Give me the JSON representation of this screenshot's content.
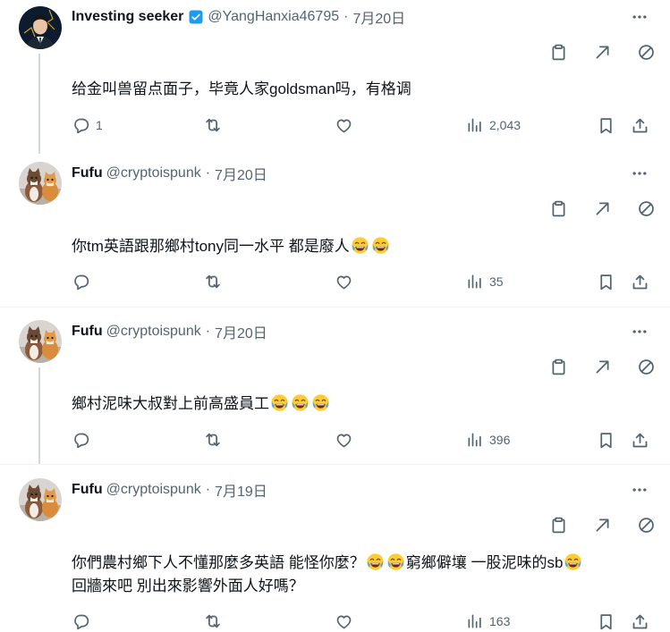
{
  "tweets": [
    {
      "name": "Investing seeker",
      "handle": "@YangHanxia46795",
      "date": "7月20日",
      "verified": true,
      "text": "给金叫兽留点面子，毕竟人家goldsman吗，有格调",
      "replies": "1",
      "views": "2,043"
    },
    {
      "name": "Fufu",
      "handle": "@cryptoispunk",
      "date": "7月20日",
      "text": "你tm英語跟那鄉村tony同一水平 都是廢人",
      "emoji_count": 2,
      "replies": "",
      "views": "35"
    },
    {
      "name": "Fufu",
      "handle": "@cryptoispunk",
      "date": "7月20日",
      "text": "鄉村泥味大叔對上前高盛員工",
      "emoji_count": 3,
      "replies": "",
      "views": "396"
    },
    {
      "name": "Fufu",
      "handle": "@cryptoispunk",
      "date": "7月19日",
      "text_line1_a": "你們農村鄉下人不懂那麼多英語 能怪你麼？",
      "text_line1_b": "窮鄉僻壤 一股泥味的sb",
      "text_line2": "回牆來吧 別出來影響外面人好嗎？",
      "replies": "",
      "views": "163"
    }
  ],
  "separator": "·",
  "colors": {
    "muted": "#536471",
    "text": "#0f1419",
    "verified": "#1d9bf0",
    "thread_line": "#cfd9de"
  },
  "icons": [
    "more-icon",
    "clipboard-icon",
    "expand-arrow-icon",
    "block-icon",
    "reply-icon",
    "retweet-icon",
    "like-icon",
    "views-icon",
    "bookmark-icon",
    "share-icon",
    "laughing-emoji"
  ]
}
